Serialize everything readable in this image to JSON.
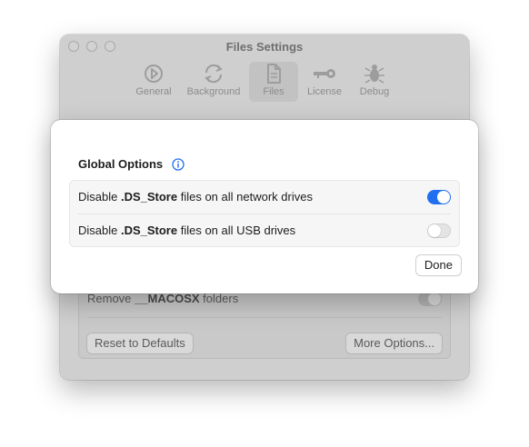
{
  "window": {
    "title": "Files Settings",
    "toolbar": [
      {
        "label": "General",
        "icon": "gauge-icon"
      },
      {
        "label": "Background",
        "icon": "refresh-icon"
      },
      {
        "label": "Files",
        "icon": "document-icon",
        "selected": true
      },
      {
        "label": "License",
        "icon": "key-icon"
      },
      {
        "label": "Debug",
        "icon": "bug-icon"
      }
    ],
    "macosx_row": {
      "prefix": "Remove ",
      "bold": "__MACOSX",
      "suffix": " folders",
      "enabled": true
    },
    "reset_button": "Reset to Defaults",
    "more_options_button": "More Options..."
  },
  "sheet": {
    "group_title": "Global Options",
    "info_icon": "info-icon",
    "options": [
      {
        "prefix": "Disable ",
        "bold": ".DS_Store",
        "suffix": " files on all network drives",
        "enabled": true
      },
      {
        "prefix": "Disable ",
        "bold": ".DS_Store",
        "suffix": " files on all USB drives",
        "enabled": false
      }
    ],
    "done_button": "Done"
  },
  "colors": {
    "accent": "#1f6ff0",
    "dimmed_window": "#cfcfcf"
  }
}
